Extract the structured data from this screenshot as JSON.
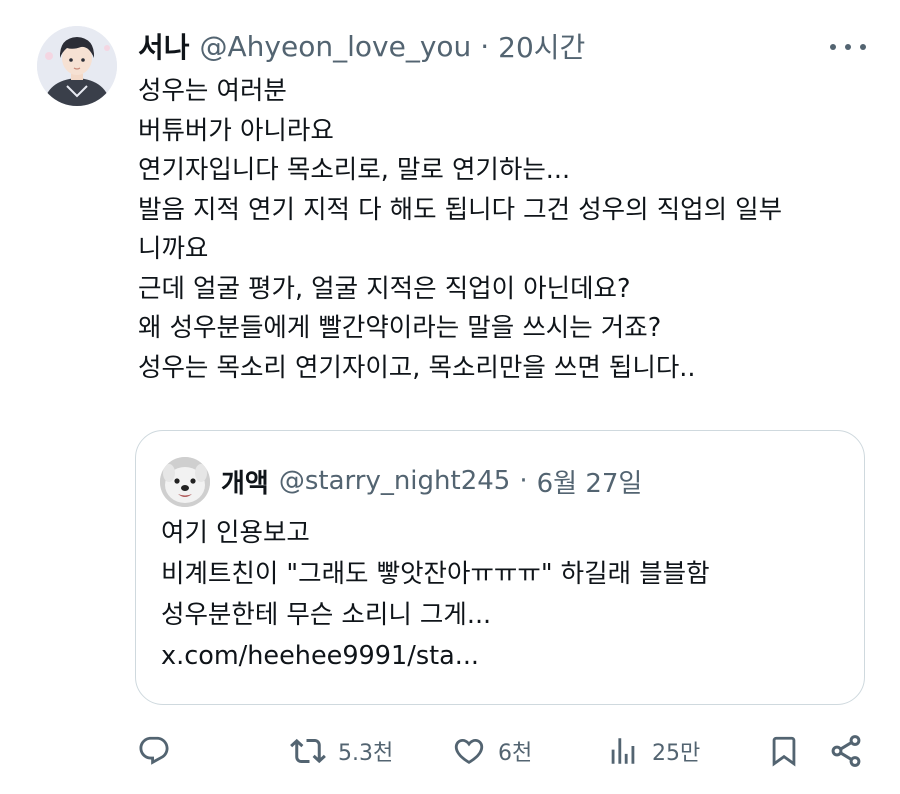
{
  "tweet": {
    "author_name": "서나",
    "author_handle": "@Ahyeon_love_you",
    "separator": "·",
    "time": "20시간",
    "more_icon": "more-horizontal-icon",
    "lines": [
      "성우는 여러분",
      "버튜버가 아니라요",
      "연기자입니다 목소리로, 말로 연기하는...",
      "발음 지적 연기 지적 다 해도 됩니다 그건 성우의 직업의 일부",
      "니까요",
      "근데 얼굴 평가, 얼굴 지적은 직업이 아닌데요?",
      "왜 성우분들에게 빨간약이라는 말을 쓰시는 거죠?",
      "성우는 목소리 연기자이고, 목소리만을 쓰면 됩니다.."
    ]
  },
  "quote": {
    "author_name": "개액",
    "author_handle": "@starry_night245",
    "separator": "·",
    "time": "6월 27일",
    "lines": [
      "여기 인용보고",
      "비계트친이 \"그래도 빻앗잔아ㅠㅠㅠ\" 하길래 블블함",
      "성우분한테 무슨 소리니 그게...",
      "x.com/heehee9991/sta..."
    ]
  },
  "actions": {
    "reply": {
      "icon": "reply-icon",
      "count": ""
    },
    "retweet": {
      "icon": "retweet-icon",
      "count": "5.3천"
    },
    "like": {
      "icon": "heart-icon",
      "count": "6천"
    },
    "views": {
      "icon": "views-icon",
      "count": "25만"
    },
    "bookmark": {
      "icon": "bookmark-icon"
    },
    "share": {
      "icon": "share-icon"
    }
  },
  "colors": {
    "text_primary": "#0f1419",
    "text_secondary": "#536471",
    "border": "#cfd9de",
    "background": "#ffffff"
  }
}
